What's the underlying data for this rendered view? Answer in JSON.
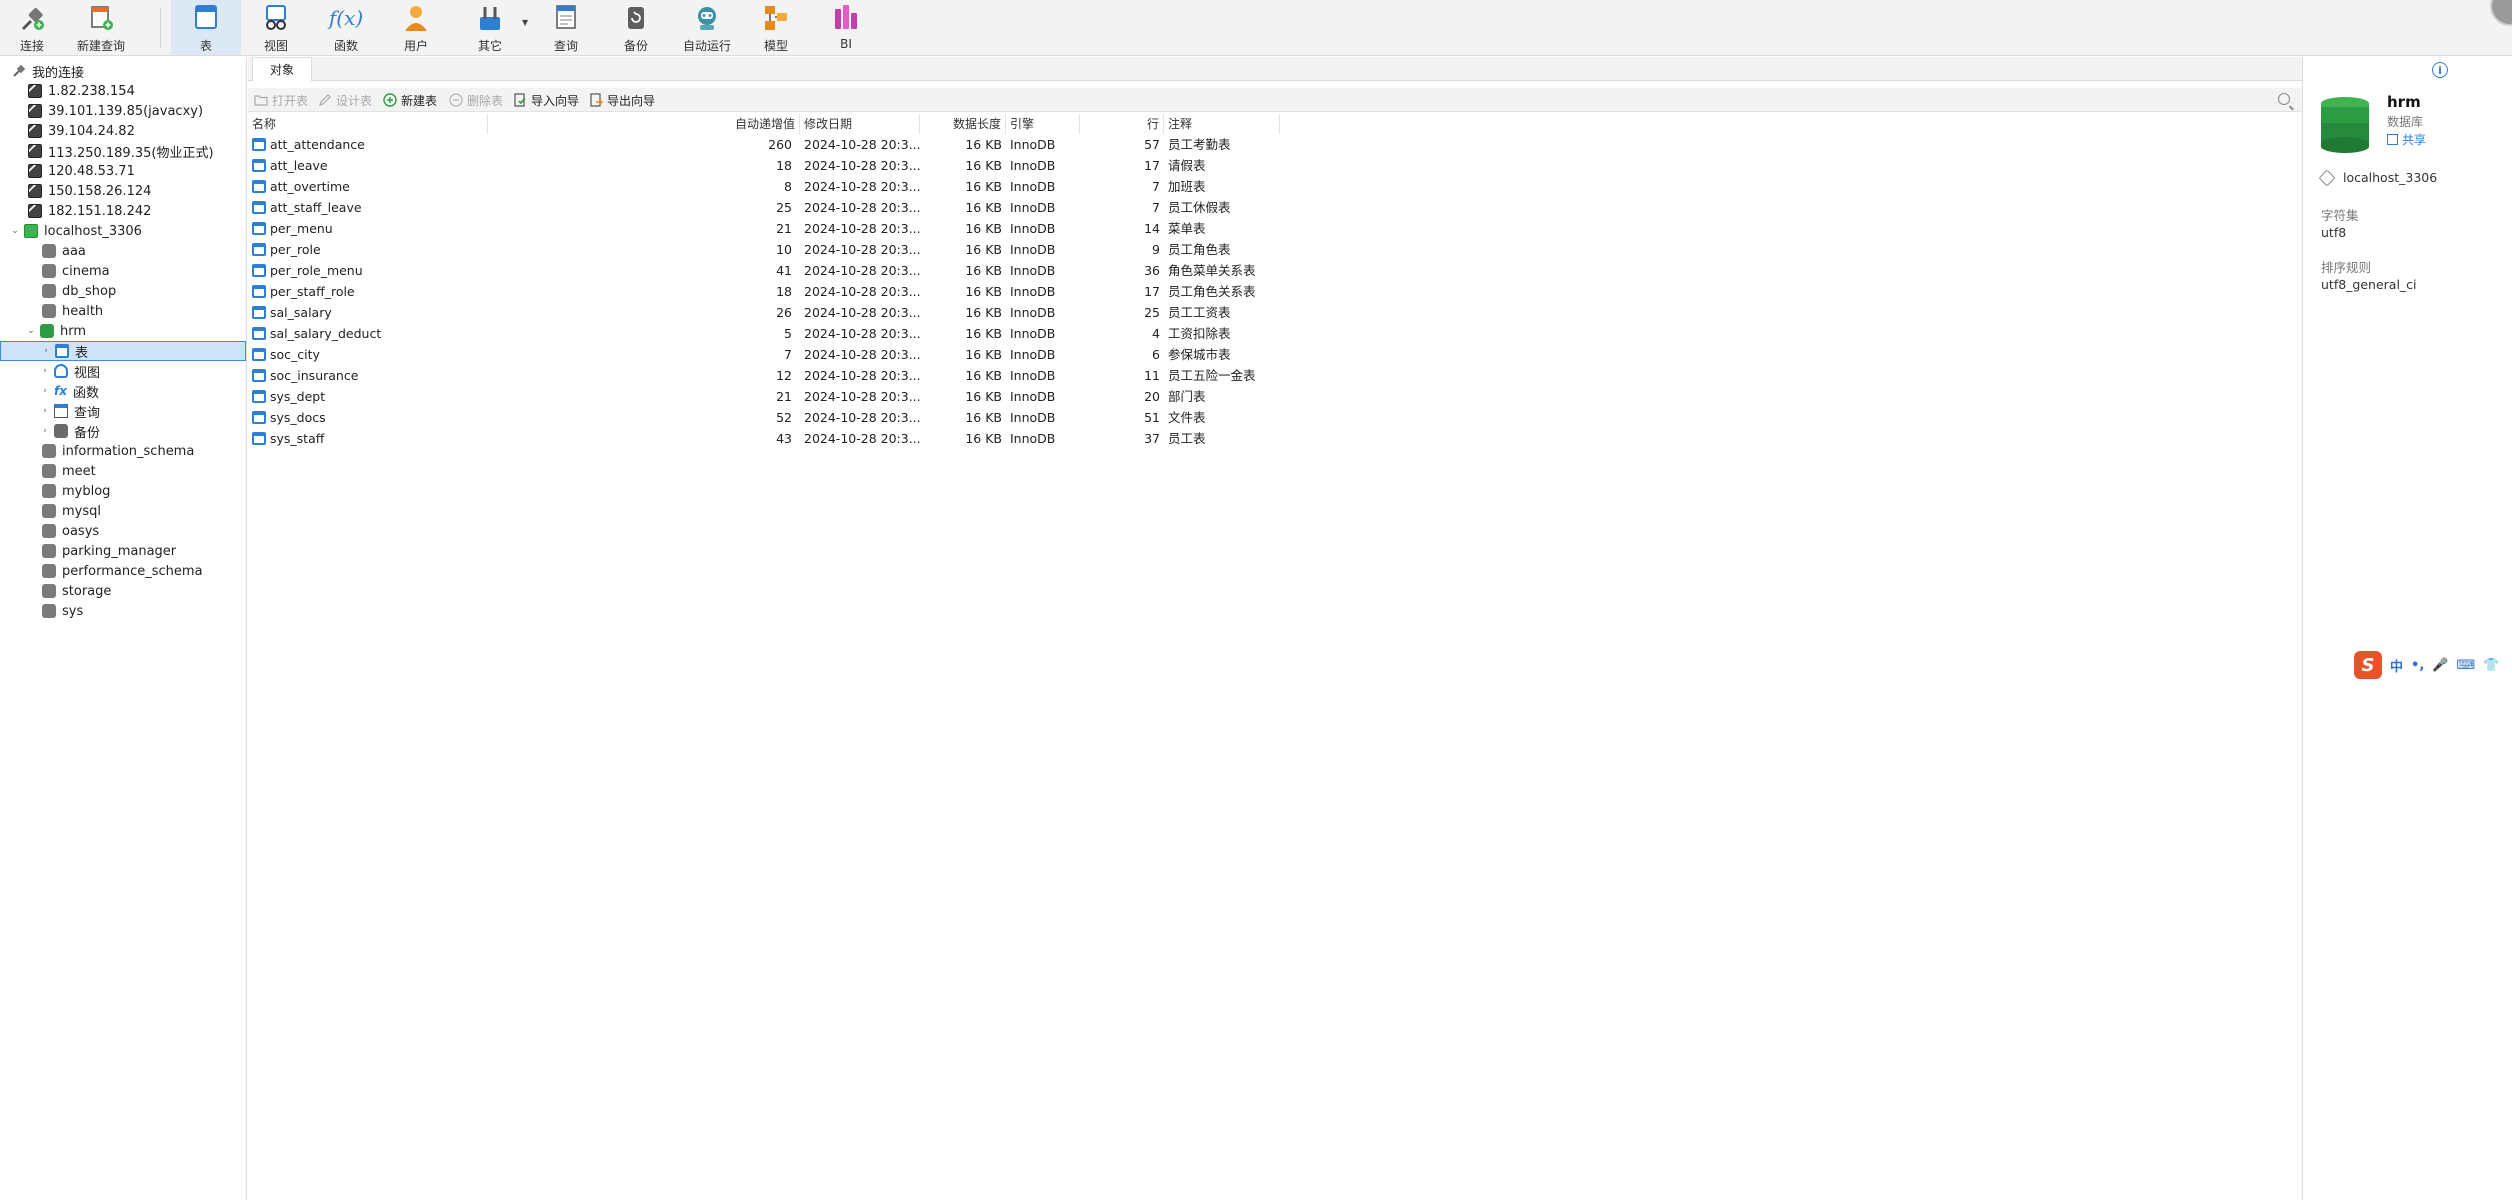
{
  "toolbar": {
    "buttons": [
      {
        "label": "连接",
        "icon": "connect-icon"
      },
      {
        "label": "新建查询",
        "icon": "new-query-icon"
      },
      {
        "label": "表",
        "icon": "table-icon"
      },
      {
        "label": "视图",
        "icon": "view-icon"
      },
      {
        "label": "函数",
        "icon": "function-icon"
      },
      {
        "label": "用户",
        "icon": "user-icon"
      },
      {
        "label": "其它",
        "icon": "other-icon"
      },
      {
        "label": "查询",
        "icon": "query-icon"
      },
      {
        "label": "备份",
        "icon": "backup-icon"
      },
      {
        "label": "自动运行",
        "icon": "automation-icon"
      },
      {
        "label": "模型",
        "icon": "model-icon"
      },
      {
        "label": "BI",
        "icon": "bi-icon"
      }
    ],
    "function_glyph": "f(x)"
  },
  "sidebar": {
    "root": "我的连接",
    "connections": [
      "1.82.238.154",
      "39.101.139.85(javacxy)",
      "39.104.24.82",
      "113.250.189.35(物业正式)",
      "120.48.53.71",
      "150.158.26.124",
      "182.151.18.242"
    ],
    "local": "localhost_3306",
    "databases_before": [
      "aaa",
      "cinema",
      "db_shop",
      "health"
    ],
    "open_db": "hrm",
    "open_db_children": [
      "表",
      "视图",
      "函数",
      "查询",
      "备份"
    ],
    "func_glyph": "fx",
    "databases_after": [
      "information_schema",
      "meet",
      "myblog",
      "mysql",
      "oasys",
      "parking_manager",
      "performance_schema",
      "storage",
      "sys"
    ]
  },
  "main": {
    "tab": "对象",
    "object_toolbar": {
      "open": "打开表",
      "design": "设计表",
      "new": "新建表",
      "delete": "删除表",
      "import": "导入向导",
      "export": "导出向导"
    },
    "columns": [
      "名称",
      "自动递增值",
      "修改日期",
      "数据长度",
      "引擎",
      "行",
      "注释"
    ],
    "rows": [
      {
        "name": "att_attendance",
        "auto_inc": "260",
        "date": "2024-10-28 20:3...",
        "size": "16 KB",
        "engine": "InnoDB",
        "rows": "57",
        "comment": "员工考勤表"
      },
      {
        "name": "att_leave",
        "auto_inc": "18",
        "date": "2024-10-28 20:3...",
        "size": "16 KB",
        "engine": "InnoDB",
        "rows": "17",
        "comment": "请假表"
      },
      {
        "name": "att_overtime",
        "auto_inc": "8",
        "date": "2024-10-28 20:3...",
        "size": "16 KB",
        "engine": "InnoDB",
        "rows": "7",
        "comment": "加班表"
      },
      {
        "name": "att_staff_leave",
        "auto_inc": "25",
        "date": "2024-10-28 20:3...",
        "size": "16 KB",
        "engine": "InnoDB",
        "rows": "7",
        "comment": "员工休假表"
      },
      {
        "name": "per_menu",
        "auto_inc": "21",
        "date": "2024-10-28 20:3...",
        "size": "16 KB",
        "engine": "InnoDB",
        "rows": "14",
        "comment": "菜单表"
      },
      {
        "name": "per_role",
        "auto_inc": "10",
        "date": "2024-10-28 20:3...",
        "size": "16 KB",
        "engine": "InnoDB",
        "rows": "9",
        "comment": "员工角色表"
      },
      {
        "name": "per_role_menu",
        "auto_inc": "41",
        "date": "2024-10-28 20:3...",
        "size": "16 KB",
        "engine": "InnoDB",
        "rows": "36",
        "comment": "角色菜单关系表"
      },
      {
        "name": "per_staff_role",
        "auto_inc": "18",
        "date": "2024-10-28 20:3...",
        "size": "16 KB",
        "engine": "InnoDB",
        "rows": "17",
        "comment": "员工角色关系表"
      },
      {
        "name": "sal_salary",
        "auto_inc": "26",
        "date": "2024-10-28 20:3...",
        "size": "16 KB",
        "engine": "InnoDB",
        "rows": "25",
        "comment": "员工工资表"
      },
      {
        "name": "sal_salary_deduct",
        "auto_inc": "5",
        "date": "2024-10-28 20:3...",
        "size": "16 KB",
        "engine": "InnoDB",
        "rows": "4",
        "comment": "工资扣除表"
      },
      {
        "name": "soc_city",
        "auto_inc": "7",
        "date": "2024-10-28 20:3...",
        "size": "16 KB",
        "engine": "InnoDB",
        "rows": "6",
        "comment": "参保城市表"
      },
      {
        "name": "soc_insurance",
        "auto_inc": "12",
        "date": "2024-10-28 20:3...",
        "size": "16 KB",
        "engine": "InnoDB",
        "rows": "11",
        "comment": "员工五险一金表"
      },
      {
        "name": "sys_dept",
        "auto_inc": "21",
        "date": "2024-10-28 20:3...",
        "size": "16 KB",
        "engine": "InnoDB",
        "rows": "20",
        "comment": "部门表"
      },
      {
        "name": "sys_docs",
        "auto_inc": "52",
        "date": "2024-10-28 20:3...",
        "size": "16 KB",
        "engine": "InnoDB",
        "rows": "51",
        "comment": "文件表"
      },
      {
        "name": "sys_staff",
        "auto_inc": "43",
        "date": "2024-10-28 20:3...",
        "size": "16 KB",
        "engine": "InnoDB",
        "rows": "37",
        "comment": "员工表"
      }
    ]
  },
  "info": {
    "info_glyph": "i",
    "name": "hrm",
    "type": "数据库",
    "share": "共享",
    "host": "localhost_3306",
    "charset_label": "字符集",
    "charset": "utf8",
    "collation_label": "排序规则",
    "collation": "utf8_general_ci"
  },
  "ime": {
    "logo": "S",
    "items": [
      "中",
      "•,",
      "🎤",
      "⌨",
      "👕"
    ]
  },
  "colors": {
    "accent": "#2d7fd3",
    "selection": "#cfe3f8",
    "db_green": "#2e9b45"
  }
}
